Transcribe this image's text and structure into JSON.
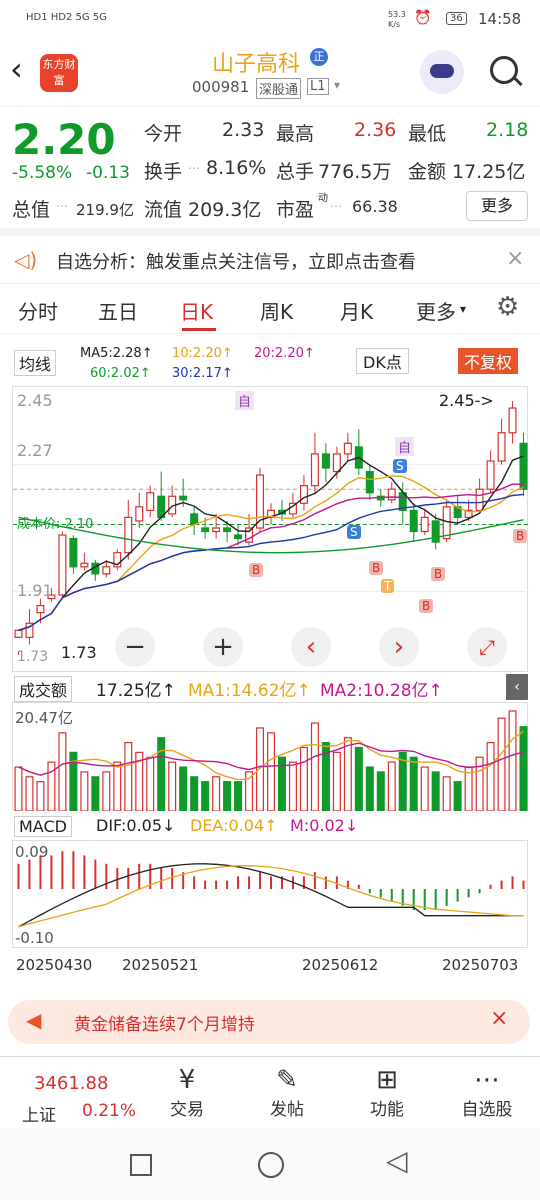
{
  "status_bar": {
    "left_icons": "HD1 HD2 5G 5G",
    "net_speed": "53.3 K/s",
    "battery": "36",
    "time": "14:58"
  },
  "header": {
    "title": "山子高科",
    "title_badge": "正",
    "code": "000981",
    "tag_connect": "深股通",
    "tag_level": "L1",
    "logo_text": "东方财富"
  },
  "quote": {
    "price": "2.20",
    "change_pct": "-5.58%",
    "change_abs": "-0.13",
    "open_label": "今开",
    "open": "2.33",
    "high_label": "最高",
    "high": "2.36",
    "low_label": "最低",
    "low": "2.18",
    "turnover_label": "换手",
    "turnover": "8.16%",
    "volume_label": "总手",
    "volume": "776.5万",
    "amount_label": "金额",
    "amount": "17.25亿",
    "mktcap_label": "总值",
    "mktcap": "219.9亿",
    "float_label": "流值",
    "float_cap": "209.3亿",
    "pe_label": "市盈",
    "pe_sup": "动",
    "pe": "66.38",
    "more_label": "更多"
  },
  "tip": {
    "text": "自选分析：触发重点关注信号，立即点击查看"
  },
  "tabs": [
    {
      "label": "分时"
    },
    {
      "label": "五日"
    },
    {
      "label": "日K"
    },
    {
      "label": "周K"
    },
    {
      "label": "月K"
    },
    {
      "label": "更多"
    }
  ],
  "colors": {
    "up": "#d62f2f",
    "down": "#0f9a2a",
    "ma5": "#222222",
    "ma10": "#e8a317",
    "ma20": "#c2188f",
    "ma30": "#1f3aa0",
    "ma60": "#0f9a2a"
  },
  "kline": {
    "ma_selector": "均线",
    "ma5": "MA5:2.28↑",
    "ma10": "10:2.20↑",
    "ma20": "20:2.20↑",
    "ma60": "60:2.02↑",
    "ma30": "30:2.17↑",
    "dk_label": "DK点",
    "fq_label": "不复权",
    "y_top": "2.45",
    "y_mid": "2.27",
    "y_cost": "2.10",
    "cost_label": "成本价: 2.10",
    "y_low": "1.91",
    "y_min": "1.73",
    "min_mark": "1.73",
    "max_mark": "2.45->",
    "marker_zi": "自",
    "marker_s": "S",
    "marker_b": "B",
    "marker_t": "T",
    "fab_minus": "−",
    "fab_plus": "+",
    "fab_left": "‹",
    "fab_right": "›",
    "fab_expand": "⤢"
  },
  "volume": {
    "selector": "成交额",
    "current": "17.25亿↑",
    "ma1": "MA1:14.62亿↑",
    "ma2": "MA2:10.28亿↑",
    "y_top": "20.47亿"
  },
  "macd": {
    "selector": "MACD",
    "dif": "DIF:0.05↓",
    "dea": "DEA:0.04↑",
    "m": "M:0.02↓",
    "y_top": "0.09",
    "y_bottom": "-0.10"
  },
  "dates": [
    "20250430",
    "20250521",
    "20250612",
    "20250703"
  ],
  "banner": {
    "text": "黄金储备连续7个月增持"
  },
  "bottom": {
    "index_value": "3461.88",
    "index_name": "上证",
    "index_pct": "0.21%",
    "items": [
      {
        "label": "交易"
      },
      {
        "label": "发帖"
      },
      {
        "label": "功能"
      },
      {
        "label": "自选股"
      }
    ]
  },
  "chart_data": {
    "type": "candlestick",
    "ylim": [
      1.73,
      2.45
    ],
    "candles": [
      [
        1.78,
        1.8,
        1.74,
        1.73
      ],
      [
        1.78,
        1.82,
        1.86,
        1.76
      ],
      [
        1.85,
        1.87,
        1.89,
        1.82
      ],
      [
        1.89,
        1.9,
        1.92,
        1.88
      ],
      [
        1.9,
        2.07,
        2.08,
        1.89
      ],
      [
        2.06,
        1.98,
        2.07,
        1.96
      ],
      [
        1.98,
        1.99,
        2.02,
        1.97
      ],
      [
        1.99,
        1.96,
        2.0,
        1.94
      ],
      [
        1.96,
        1.98,
        2.0,
        1.95
      ],
      [
        1.98,
        2.02,
        2.03,
        1.97
      ],
      [
        2.02,
        2.12,
        2.17,
        2.0
      ],
      [
        2.11,
        2.15,
        2.19,
        2.09
      ],
      [
        2.14,
        2.19,
        2.21,
        2.12
      ],
      [
        2.18,
        2.12,
        2.25,
        2.11
      ],
      [
        2.13,
        2.18,
        2.21,
        2.12
      ],
      [
        2.18,
        2.17,
        2.23,
        2.15
      ],
      [
        2.13,
        2.1,
        2.15,
        2.07
      ],
      [
        2.09,
        2.08,
        2.12,
        2.06
      ],
      [
        2.08,
        2.09,
        2.13,
        2.06
      ],
      [
        2.09,
        2.08,
        2.11,
        2.05
      ],
      [
        2.07,
        2.06,
        2.1,
        2.04
      ],
      [
        2.05,
        2.09,
        2.13,
        2.04
      ],
      [
        2.09,
        2.24,
        2.26,
        2.08
      ],
      [
        2.12,
        2.14,
        2.16,
        2.1
      ],
      [
        2.14,
        2.13,
        2.17,
        2.11
      ],
      [
        2.13,
        2.16,
        2.19,
        2.12
      ],
      [
        2.16,
        2.21,
        2.24,
        2.14
      ],
      [
        2.21,
        2.3,
        2.36,
        2.19
      ],
      [
        2.3,
        2.26,
        2.33,
        2.22
      ],
      [
        2.25,
        2.3,
        2.32,
        2.23
      ],
      [
        2.3,
        2.33,
        2.36,
        2.28
      ],
      [
        2.32,
        2.26,
        2.37,
        2.24
      ],
      [
        2.25,
        2.19,
        2.27,
        2.17
      ],
      [
        2.18,
        2.17,
        2.2,
        2.15
      ],
      [
        2.17,
        2.2,
        2.22,
        2.16
      ],
      [
        2.19,
        2.14,
        2.22,
        2.1
      ],
      [
        2.14,
        2.08,
        2.16,
        2.05
      ],
      [
        2.08,
        2.12,
        2.14,
        2.07
      ],
      [
        2.11,
        2.05,
        2.13,
        2.03
      ],
      [
        2.06,
        2.15,
        2.17,
        2.05
      ],
      [
        2.15,
        2.12,
        2.18,
        2.1
      ],
      [
        2.12,
        2.14,
        2.17,
        2.11
      ],
      [
        2.14,
        2.2,
        2.23,
        2.13
      ],
      [
        2.2,
        2.28,
        2.31,
        2.19
      ],
      [
        2.28,
        2.36,
        2.4,
        2.27
      ],
      [
        2.36,
        2.43,
        2.45,
        2.33
      ],
      [
        2.33,
        2.2,
        2.36,
        2.18
      ]
    ],
    "volume": [
      9,
      7,
      6,
      10,
      16,
      12,
      8,
      7,
      8,
      10,
      14,
      12,
      11,
      15,
      10,
      9,
      7,
      6,
      7,
      6,
      6,
      8,
      17,
      16,
      11,
      10,
      13,
      18,
      14,
      12,
      15,
      13,
      9,
      8,
      10,
      12,
      11,
      9,
      8,
      7,
      6,
      9,
      11,
      14,
      19,
      20.47,
      17.25
    ],
    "macd_hist": [
      0.06,
      0.07,
      0.08,
      0.08,
      0.09,
      0.09,
      0.08,
      0.07,
      0.06,
      0.05,
      0.05,
      0.06,
      0.06,
      0.05,
      0.05,
      0.04,
      0.03,
      0.02,
      0.02,
      0.02,
      0.03,
      0.03,
      0.04,
      0.03,
      0.03,
      0.03,
      0.03,
      0.04,
      0.03,
      0.03,
      0.02,
      0.01,
      -0.01,
      -0.02,
      -0.03,
      -0.04,
      -0.05,
      -0.05,
      -0.05,
      -0.04,
      -0.03,
      -0.02,
      -0.01,
      0.01,
      0.02,
      0.03,
      0.02
    ]
  }
}
